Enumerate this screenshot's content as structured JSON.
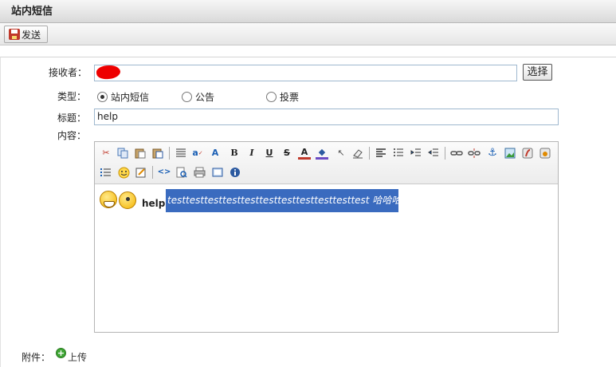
{
  "window": {
    "title": "站内短信"
  },
  "toolbar": {
    "send_label": "发送"
  },
  "form": {
    "recipient_label": "接收者：",
    "recipient_value": "",
    "choose_label": "选择",
    "type_label": "类型：",
    "types": [
      {
        "label": "站内短信",
        "selected": true
      },
      {
        "label": "公告",
        "selected": false
      },
      {
        "label": "投票",
        "selected": false
      }
    ],
    "subject_label": "标题：",
    "subject_value": "help",
    "content_label": "内容："
  },
  "editor": {
    "toolbar_row1": [
      "cut-icon",
      "copy-icon",
      "paste-icon",
      "paste-text-icon",
      "paste-word-icon",
      "justify-icon",
      "spellcheck-icon",
      "font-size-icon",
      "bold-icon",
      "italic-icon",
      "underline-icon",
      "strikethrough-icon",
      "text-color-icon",
      "highlight-color-icon",
      "select-icon",
      "eraser-icon",
      "align-left-icon",
      "ordered-list-icon",
      "indent-icon",
      "outdent-icon",
      "link-icon",
      "unlink-icon",
      "anchor-icon",
      "image-icon",
      "flash-icon",
      "media-icon"
    ],
    "toolbar_row2": [
      "bullet-list-icon",
      "smiley-icon",
      "edit-form-icon",
      "source-code-icon",
      "preview-icon",
      "print-icon",
      "fullscreen-icon",
      "about-icon"
    ],
    "bold_glyph": "B",
    "italic_glyph": "I",
    "underline_glyph": "U",
    "strike_glyph": "S",
    "color_glyph": "A",
    "content_bold": "help",
    "content_selected": "testtesttesttesttesttesttesttesttesttesttest 哈哈哈哈和"
  },
  "attachment": {
    "label": "附件：",
    "upload_label": "上传"
  },
  "colors": {
    "selection": "#3a6bbf",
    "input_border": "#9fb8cf",
    "redaction": "#ee0000"
  }
}
